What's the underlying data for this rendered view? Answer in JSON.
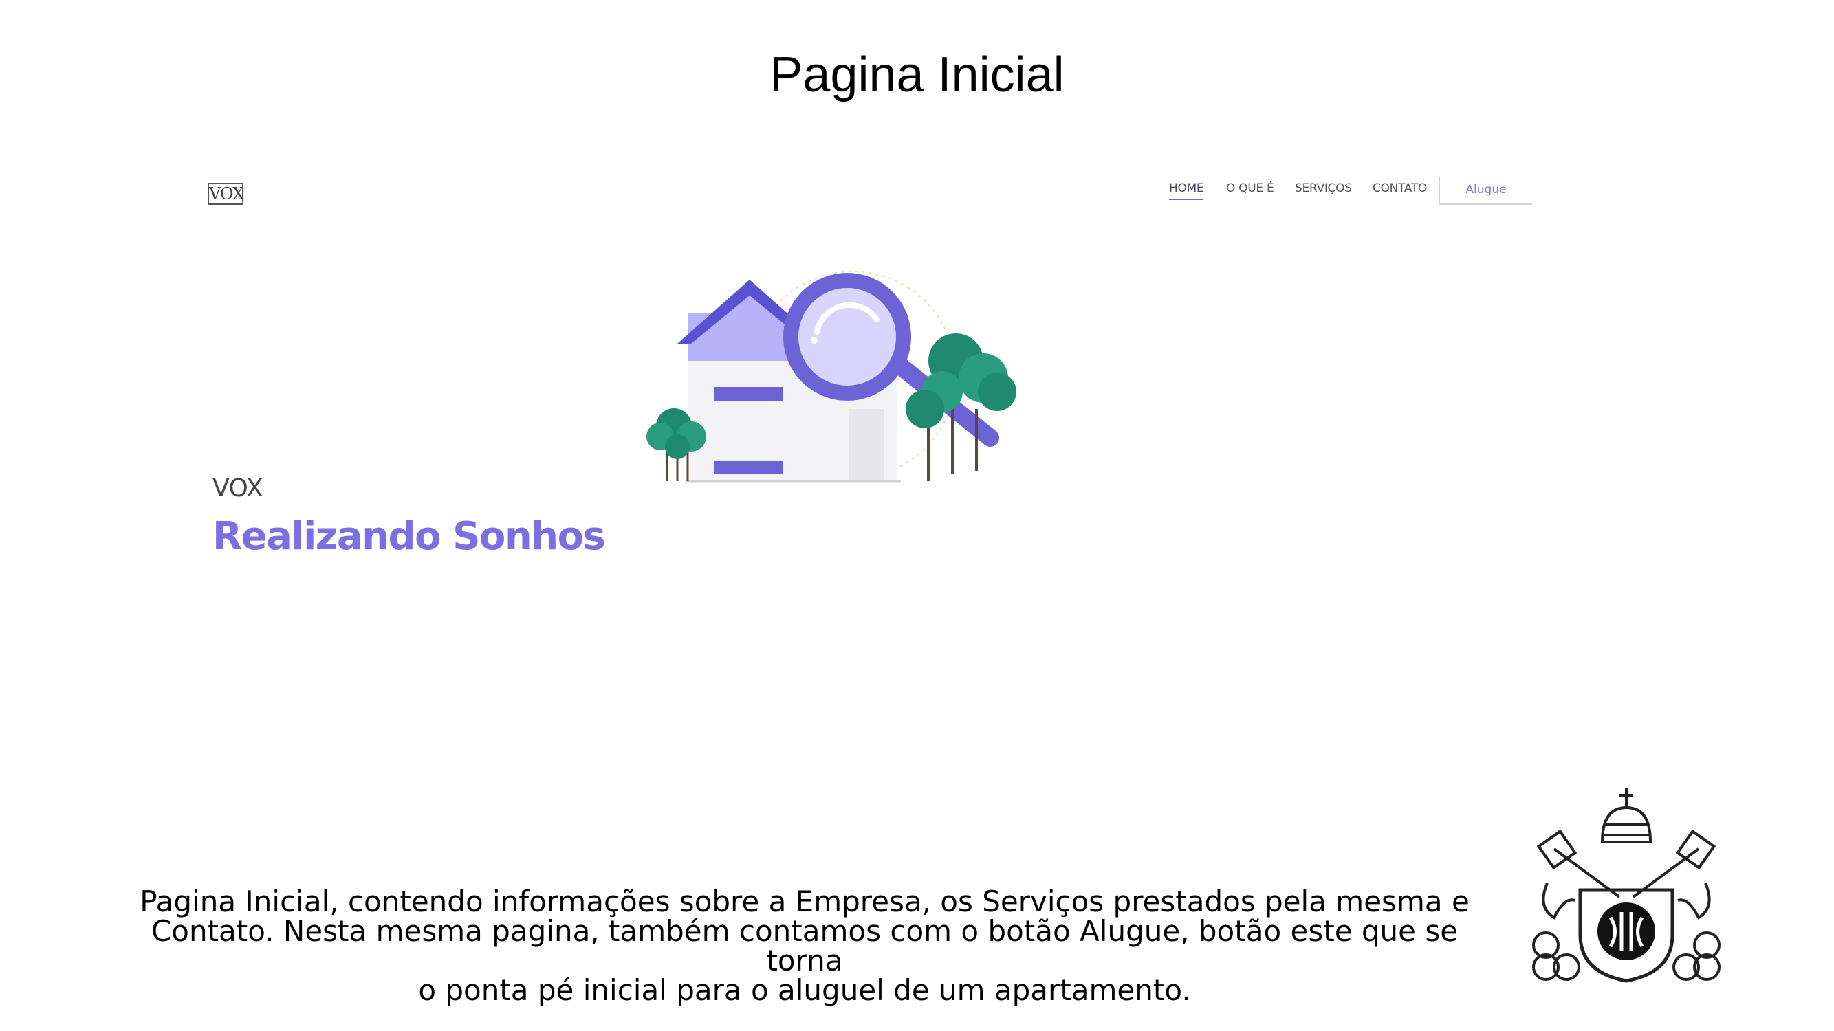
{
  "slide": {
    "title": "Pagina Inicial",
    "caption_lines": [
      "Pagina Inicial, contendo informações sobre a Empresa, os Serviços prestados pela mesma e",
      "Contato. Nesta mesma pagina, também contamos com o botão Alugue, botão este que se torna",
      "o ponta pé inicial para o aluguel de um apartamento."
    ]
  },
  "site": {
    "logo_text": "VOX",
    "nav": {
      "home": "HOME",
      "about": "O QUE É",
      "services": "SERVIÇOS",
      "contact": "CONTATO",
      "cta": "Alugue"
    },
    "hero": {
      "subtitle": "VOX",
      "title": "Realizando Sonhos"
    },
    "illustration_icons": [
      "house-icon",
      "magnifier-icon",
      "tree-icon"
    ]
  },
  "colors": {
    "accent": "#7b6fe4",
    "accent_dark": "#5a52d4",
    "tree_green": "#1f8a6e"
  }
}
